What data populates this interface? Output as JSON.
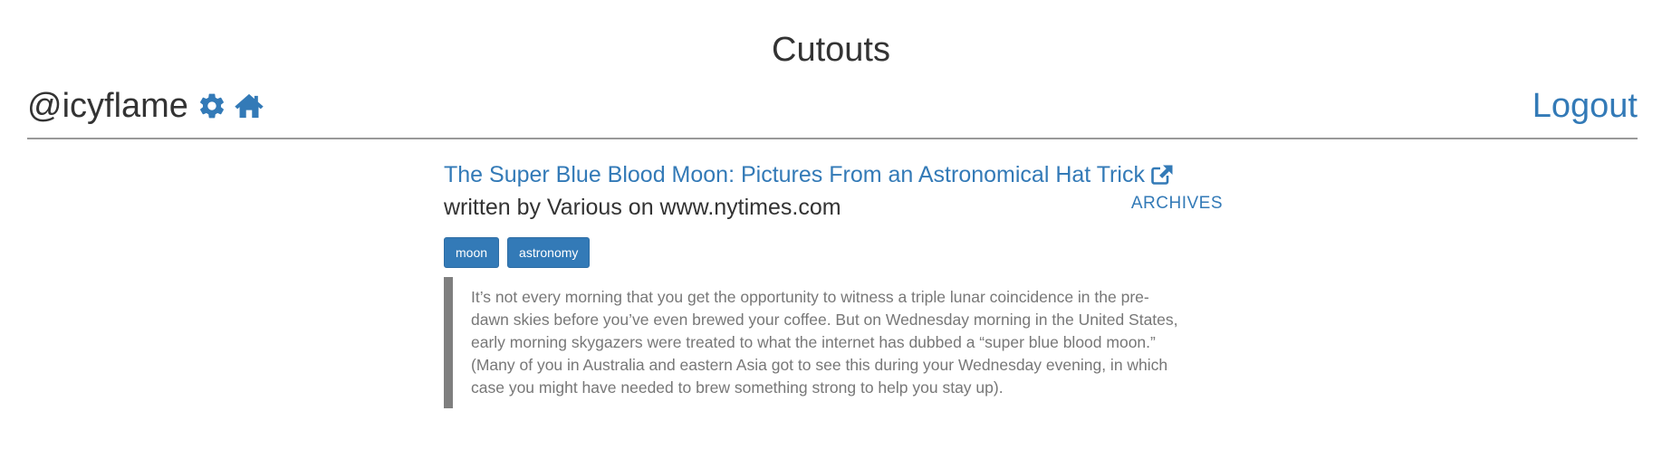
{
  "app": {
    "title": "Cutouts"
  },
  "header": {
    "username": "@icyflame",
    "settings_icon": "gear-icon",
    "home_icon": "home-icon",
    "logout_label": "Logout"
  },
  "article": {
    "title": "The Super Blue Blood Moon: Pictures From an Astronomical Hat Trick",
    "external_link_icon": "external-link-icon",
    "byline": "written by Various on www.nytimes.com",
    "archives_label": "ARCHIVES",
    "tags": [
      "moon",
      "astronomy"
    ],
    "excerpt": "It’s not every morning that you get the opportunity to witness a triple lunar coincidence in the pre-dawn skies before you’ve even brewed your coffee. But on Wednesday morning in the United States, early morning skygazers were treated to what the internet has dubbed a “super blue blood moon.” (Many of you in Australia and eastern Asia got to see this during your Wednesday evening, in which case you might have needed to brew something strong to help you stay up)."
  },
  "colors": {
    "link": "#337ab7",
    "text": "#333333",
    "muted_text": "#777777",
    "blockquote_border": "#7f7f7f",
    "divider": "#999999"
  }
}
